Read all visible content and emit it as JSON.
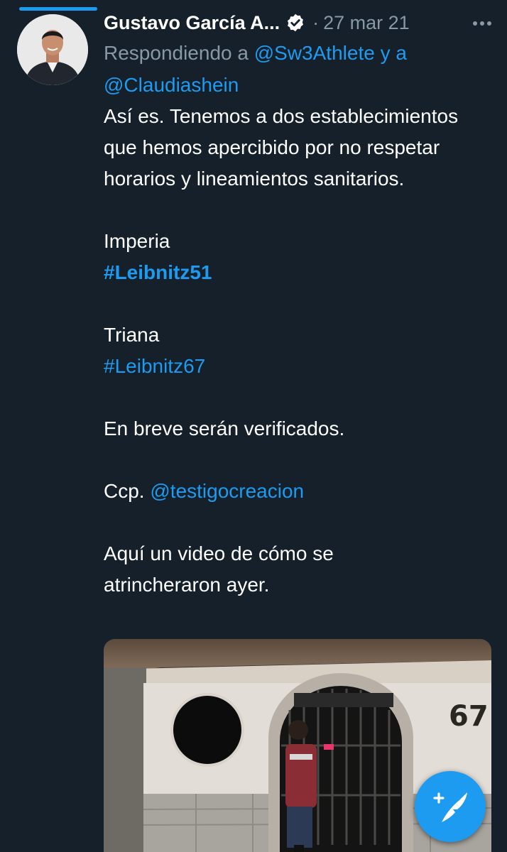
{
  "tweet": {
    "author_name": "Gustavo García A...",
    "separator": "·",
    "date": "27 mar 21",
    "replying_prefix": "Respondiendo a",
    "replying_user_1": "@Sw3Athlete",
    "replying_joiner": "y a",
    "replying_user_2": "@Claudiashein",
    "para1": "Así es. Tenemos a dos establecimientos que hemos apercibido por no respetar horarios y lineamientos sanitarios.",
    "venue1_name": "Imperia",
    "venue1_hashtag": "#Leibnitz51",
    "venue2_name": "Triana",
    "venue2_hashtag": "#Leibnitz67",
    "para_verify": "En breve serán verificados.",
    "ccp_prefix": "Ccp.",
    "ccp_user": "@testigocreacion",
    "para_video": "Aquí un video de cómo se atrincheraron ayer."
  },
  "media": {
    "sign_number": "67"
  },
  "icons": {
    "verified": "verified-badge-icon",
    "more": "more-options-icon",
    "compose": "compose-tweet-icon"
  },
  "colors": {
    "background": "#15202b",
    "accent": "#1d9bf0",
    "secondary_text": "#8899a6"
  }
}
